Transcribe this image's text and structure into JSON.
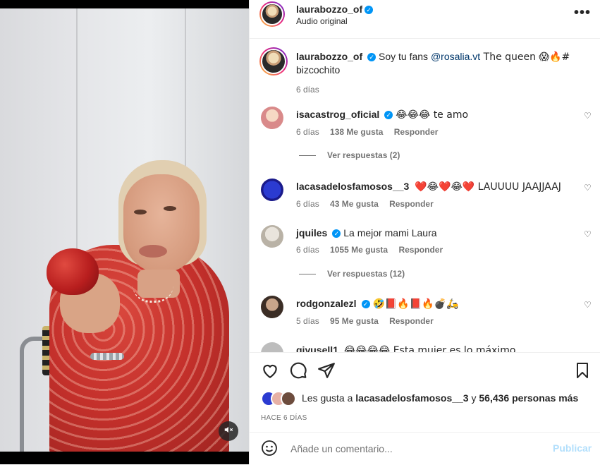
{
  "header": {
    "username": "laurabozzo_of",
    "subtitle": "Audio original",
    "more_icon": "more-horizontal-icon"
  },
  "caption": {
    "username": "laurabozzo_of",
    "text_before": "Soy tu fans ",
    "mention": "@rosalia.vt",
    "text_after": " The queen 😱🔥#",
    "text_line2": "bizcochito",
    "time": "6 días"
  },
  "comments": [
    {
      "username": "isacastrog_oficial",
      "verified": true,
      "text": "😂😂😂 te amo",
      "time": "6 días",
      "likes": "138 Me gusta",
      "reply": "Responder",
      "view_replies": "Ver respuestas (2)"
    },
    {
      "username": "lacasadelosfamosos__3",
      "verified": false,
      "text": "❤️😂❤️😂❤️ LAUUUU JAAJJAAJ",
      "time": "6 días",
      "likes": "43 Me gusta",
      "reply": "Responder",
      "view_replies": ""
    },
    {
      "username": "jquiles",
      "verified": true,
      "text": "La mejor mami Laura",
      "time": "6 días",
      "likes": "1055 Me gusta",
      "reply": "Responder",
      "view_replies": "Ver respuestas (12)"
    },
    {
      "username": "rodgonzalezl",
      "verified": true,
      "text": "🤣📕🔥📕🔥💣🛵",
      "time": "5 días",
      "likes": "95 Me gusta",
      "reply": "Responder",
      "view_replies": ""
    },
    {
      "username": "giyusell1",
      "verified": false,
      "text": "😂😂😂😂 Esta mujer es lo máximo",
      "time": "",
      "likes": "",
      "reply": "",
      "view_replies": ""
    }
  ],
  "actions": {
    "like_icon": "heart-icon",
    "comment_icon": "comment-icon",
    "share_icon": "send-icon",
    "save_icon": "bookmark-icon"
  },
  "likes": {
    "prefix": "Les gusta a ",
    "user": "lacasadelosfamosos__3",
    "middle": " y ",
    "count": "56,436 personas más"
  },
  "date": "HACE 6 DÍAS",
  "add_comment": {
    "placeholder": "Añade un comentario...",
    "emoji_icon": "emoji-icon",
    "publish": "Publicar"
  },
  "video": {
    "mute_icon": "muted-speaker-icon"
  },
  "colors": {
    "verified": "#0095f6",
    "link": "#00376b",
    "muted_text": "#737373",
    "publish_disabled": "#b2dffc"
  }
}
